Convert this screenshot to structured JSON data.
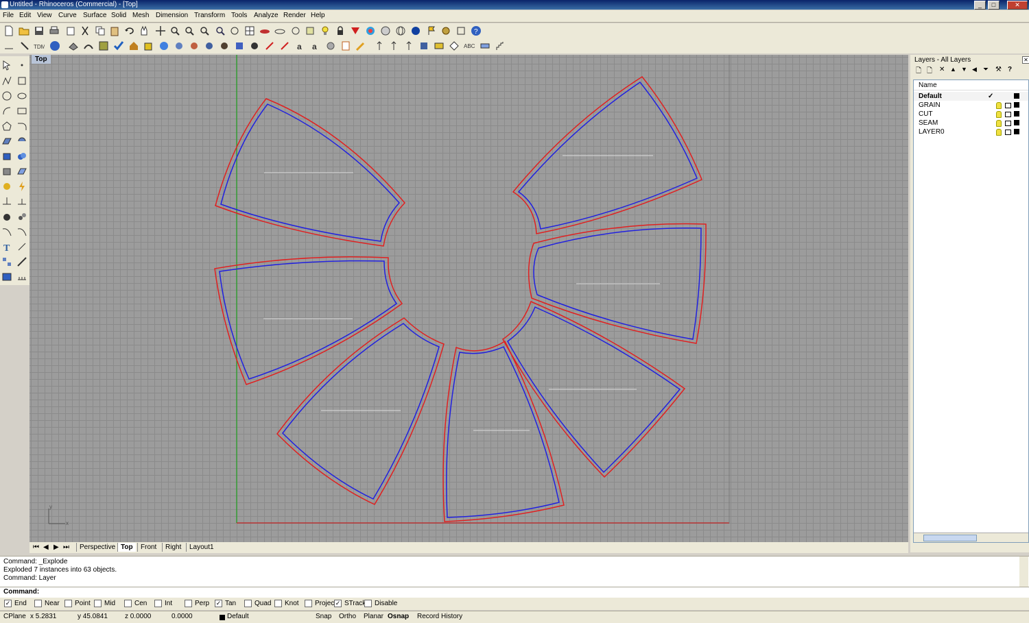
{
  "window": {
    "title": "Untitled - Rhinoceros (Commercial) - [Top]"
  },
  "menu": [
    "File",
    "Edit",
    "View",
    "Curve",
    "Surface",
    "Solid",
    "Mesh",
    "Dimension",
    "Transform",
    "Tools",
    "Analyze",
    "Render",
    "Help"
  ],
  "viewport": {
    "label": "Top"
  },
  "tabs": {
    "items": [
      "Perspective",
      "Top",
      "Front",
      "Right",
      "Layout1"
    ],
    "active": "Top"
  },
  "command": {
    "history": [
      "Command: _Explode",
      "Exploded 7 instances into 63 objects.",
      "Command: Layer"
    ],
    "prompt": "Command:"
  },
  "osnap": [
    {
      "label": "End",
      "checked": true
    },
    {
      "label": "Near",
      "checked": false
    },
    {
      "label": "Point",
      "checked": false
    },
    {
      "label": "Mid",
      "checked": false
    },
    {
      "label": "Cen",
      "checked": false
    },
    {
      "label": "Int",
      "checked": false
    },
    {
      "label": "Perp",
      "checked": false
    },
    {
      "label": "Tan",
      "checked": true
    },
    {
      "label": "Quad",
      "checked": false
    },
    {
      "label": "Knot",
      "checked": false
    },
    {
      "label": "Project",
      "checked": false
    },
    {
      "label": "STrack",
      "checked": true
    },
    {
      "label": "Disable",
      "checked": false
    }
  ],
  "status": {
    "cplane": "CPlane",
    "x": "x 5.2831",
    "y": "y 45.0841",
    "z": "z 0.0000",
    "d": "0.0000",
    "layer": "Default",
    "snap": "Snap",
    "ortho": "Ortho",
    "planar": "Planar",
    "osnap": "Osnap",
    "history": "Record History"
  },
  "layers": {
    "title": "Layers - All Layers",
    "header": "Name",
    "current_mark": "✓",
    "rows": [
      {
        "name": "Default",
        "current": true
      },
      {
        "name": "GRAIN"
      },
      {
        "name": "CUT"
      },
      {
        "name": "SEAM"
      },
      {
        "name": "LAYER0"
      }
    ]
  },
  "axis": {
    "y": "y",
    "x": "x"
  },
  "colors": {
    "cut": "#e02020",
    "seam": "#2020e0",
    "grain": "#dcdcdc",
    "y_axis": "#20a020",
    "x_axis": "#c02020"
  }
}
